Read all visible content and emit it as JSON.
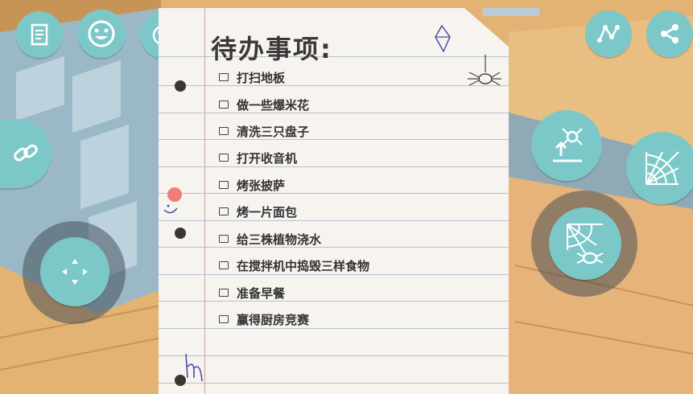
{
  "todo": {
    "title": "待办事项:",
    "items": [
      "打扫地板",
      "做一些爆米花",
      "清洗三只盘子",
      "打开收音机",
      "烤张披萨",
      "烤一片面包",
      "给三株植物浇水",
      "在搅拌机中捣毁三样食物",
      "准备早餐",
      "赢得厨房竞赛"
    ]
  },
  "colors": {
    "button": "#7cc8c8",
    "paper": "#f7f3ef",
    "marker": "#f27b7b"
  },
  "icons": {
    "top_left": [
      "notes-icon",
      "smiley-icon",
      "palette-icon"
    ],
    "top_right": [
      "nodes-icon",
      "share-icon"
    ],
    "left": [
      "link-icon",
      "move-arrows-icon"
    ],
    "right": [
      "climb-icon",
      "spiderweb-icon",
      "web-spider-icon"
    ]
  }
}
